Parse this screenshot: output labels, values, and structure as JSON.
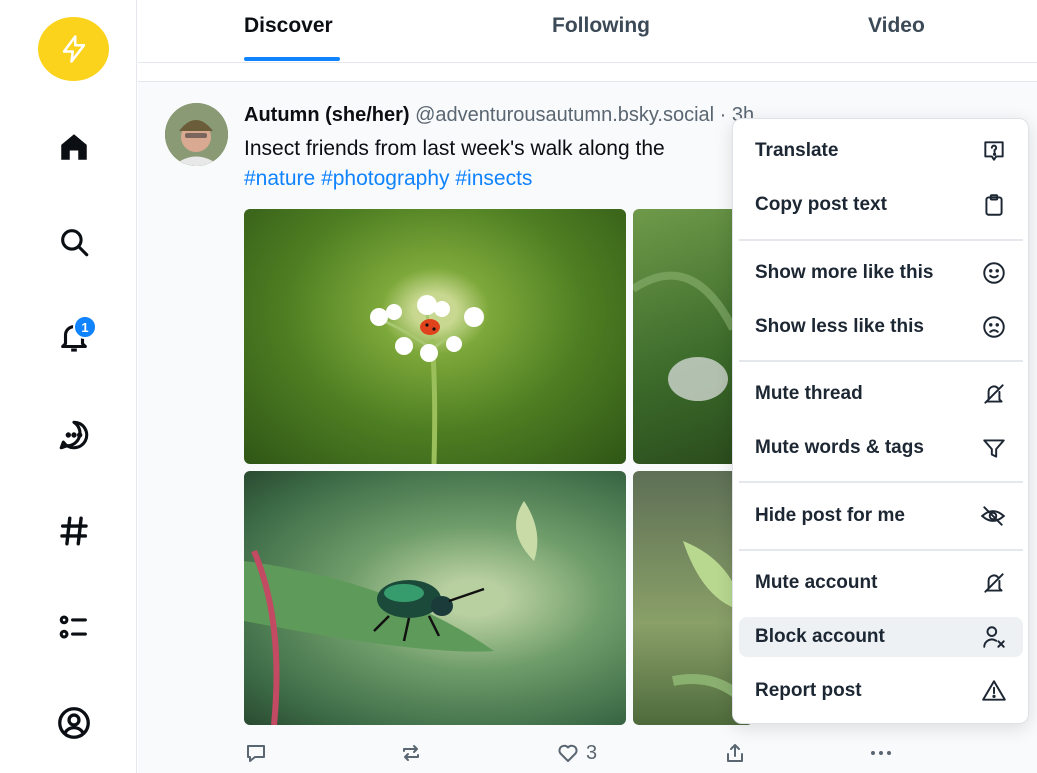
{
  "tabs": [
    {
      "label": "Discover",
      "active": true
    },
    {
      "label": "Following",
      "active": false
    },
    {
      "label": "Video",
      "active": false
    }
  ],
  "sidebar": {
    "items": [
      {
        "name": "home",
        "icon": "home-icon"
      },
      {
        "name": "search",
        "icon": "search-icon"
      },
      {
        "name": "notifications",
        "icon": "bell-icon",
        "badge": "1"
      },
      {
        "name": "chat",
        "icon": "chat-icon"
      },
      {
        "name": "feeds",
        "icon": "hash-icon"
      },
      {
        "name": "lists",
        "icon": "list-icon"
      },
      {
        "name": "profile",
        "icon": "user-circle-icon"
      }
    ]
  },
  "post": {
    "display_name": "Autumn (she/her)",
    "handle": "@adventurousautumn.bsky.social · 3h",
    "text": "Insect friends from last week's walk along the",
    "tags": [
      "#nature",
      "#photography",
      "#insects"
    ],
    "like_count": "3"
  },
  "menu": {
    "items": [
      {
        "label": "Translate",
        "icon": "translate-icon"
      },
      {
        "label": "Copy post text",
        "icon": "clipboard-icon"
      },
      {
        "label": "Show more like this",
        "icon": "smile-icon"
      },
      {
        "label": "Show less like this",
        "icon": "frown-icon"
      },
      {
        "label": "Mute thread",
        "icon": "mute-icon"
      },
      {
        "label": "Mute words & tags",
        "icon": "filter-icon"
      },
      {
        "label": "Hide post for me",
        "icon": "eye-off-icon"
      },
      {
        "label": "Mute account",
        "icon": "mute-icon"
      },
      {
        "label": "Block account",
        "icon": "block-person-icon"
      },
      {
        "label": "Report post",
        "icon": "warning-icon"
      }
    ]
  },
  "colors": {
    "accent": "#1083fe",
    "logo": "#fbd31c"
  }
}
